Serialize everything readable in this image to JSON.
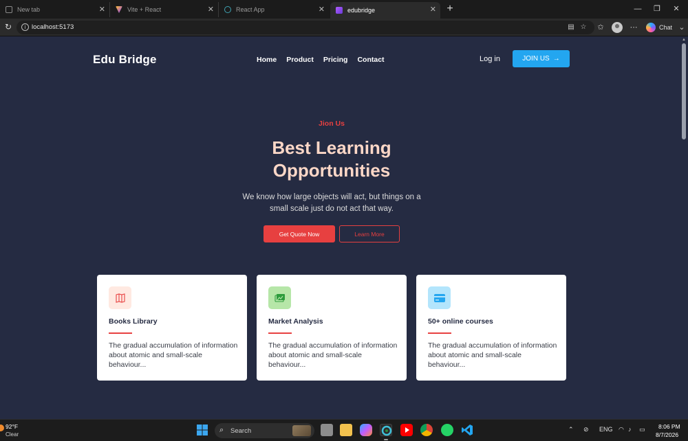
{
  "browser": {
    "tabs": [
      {
        "title": "New tab",
        "active": false
      },
      {
        "title": "Vite + React",
        "active": false
      },
      {
        "title": "React App",
        "active": false
      },
      {
        "title": "edubridge",
        "active": true
      }
    ],
    "url": "localhost:5173",
    "chat_label": "Chat"
  },
  "site": {
    "logo": "Edu Bridge",
    "nav": [
      "Home",
      "Product",
      "Pricing",
      "Contact"
    ],
    "login": "Log in",
    "join_button": "JOIN US",
    "join_arrow": "→"
  },
  "hero": {
    "eyebrow": "Jion Us",
    "headline_line1": "Best Learning",
    "headline_line2": "Opportunities",
    "subtext_line1": "We know how large objects will act, but things on a",
    "subtext_line2": "small scale just do not act that way.",
    "primary_button": "Get Quote Now",
    "secondary_button": "Learn More"
  },
  "cards": [
    {
      "title": "Books Library",
      "desc": "The gradual accumulation of information about atomic and small-scale behaviour...",
      "icon": "book-icon",
      "icon_bg": "#ffe9e1",
      "icon_color": "#e74040"
    },
    {
      "title": "Market Analysis",
      "desc": "The gradual accumulation of information about atomic and small-scale behaviour...",
      "icon": "chart-icon",
      "icon_bg": "#b6e6a8",
      "icon_color": "#2d9c3c"
    },
    {
      "title": "50+ online courses",
      "desc": "The gradual accumulation of information about atomic and small-scale behaviour...",
      "icon": "credit-card-icon",
      "icon_bg": "#b3e5fc",
      "icon_color": "#23a6f0"
    }
  ],
  "colors": {
    "page_bg": "#252b42",
    "accent_red": "#e74040",
    "accent_blue": "#23a6f0",
    "headline": "#fcd7c7"
  },
  "taskbar": {
    "temperature": "92°F",
    "condition": "Clear",
    "search_label": "Search",
    "language": "ENG",
    "time": "8:06 PM",
    "date": "8/7/2026"
  }
}
